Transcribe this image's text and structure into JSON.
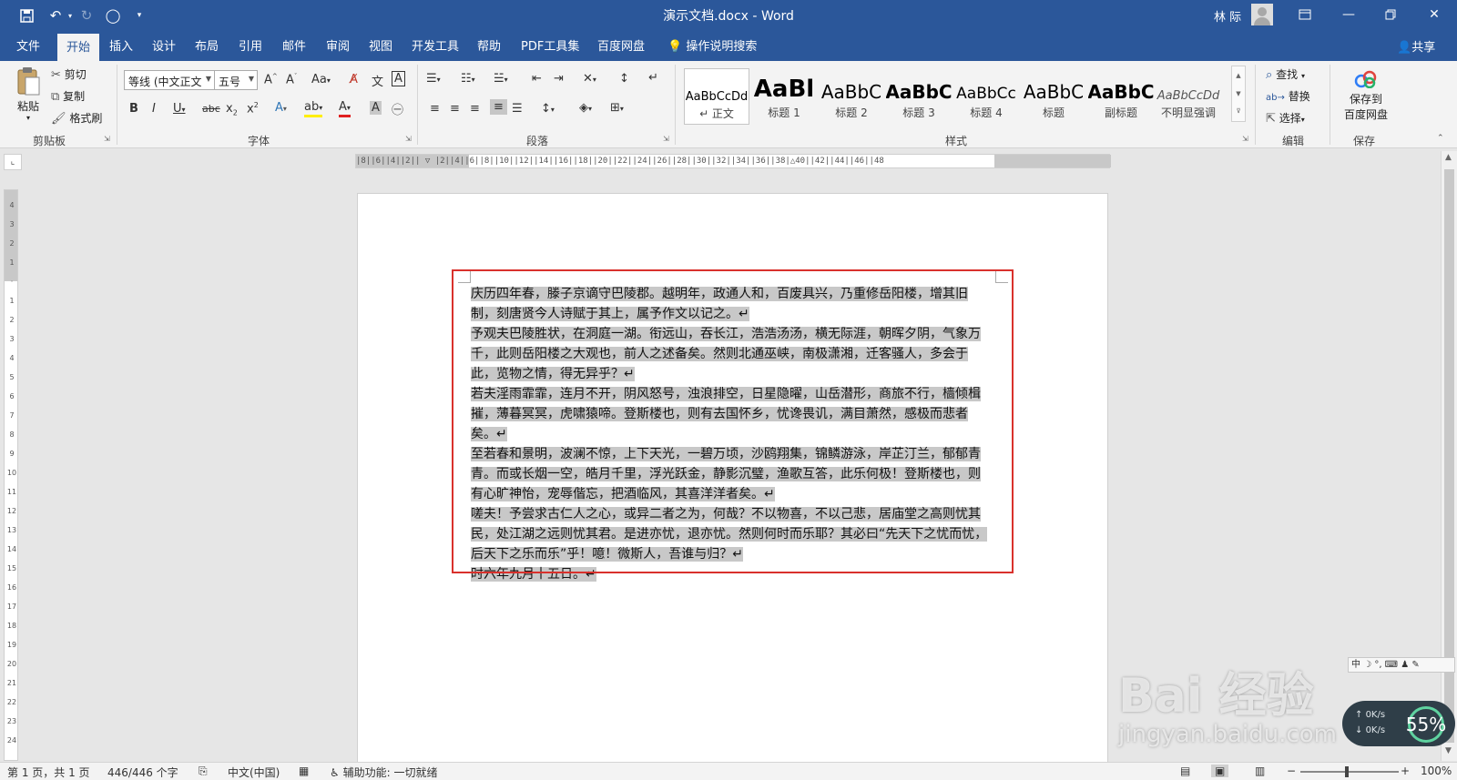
{
  "window": {
    "title": "演示文档.docx",
    "separator": "-",
    "app": "Word",
    "user": "林 际"
  },
  "tabs": [
    {
      "label": "文件"
    },
    {
      "label": "开始"
    },
    {
      "label": "插入"
    },
    {
      "label": "设计"
    },
    {
      "label": "布局"
    },
    {
      "label": "引用"
    },
    {
      "label": "邮件"
    },
    {
      "label": "审阅"
    },
    {
      "label": "视图"
    },
    {
      "label": "开发工具"
    },
    {
      "label": "帮助"
    },
    {
      "label": "PDF工具集"
    },
    {
      "label": "百度网盘"
    }
  ],
  "tell_me": "操作说明搜索",
  "share": "共享",
  "clipboard": {
    "paste": "粘贴",
    "cut": "剪切",
    "copy": "复制",
    "format_painter": "格式刷",
    "group": "剪贴板"
  },
  "font": {
    "name": "等线 (中文正文",
    "size": "五号",
    "group": "字体"
  },
  "paragraph": {
    "group": "段落"
  },
  "styles": {
    "group": "样式",
    "items": [
      {
        "sample": "AaBbCcDd",
        "name": "↵ 正文"
      },
      {
        "sample": "AaBl",
        "name": "标题 1"
      },
      {
        "sample": "AaBbC",
        "name": "标题 2"
      },
      {
        "sample": "AaBbC",
        "name": "标题 3"
      },
      {
        "sample": "AaBbCc",
        "name": "标题 4"
      },
      {
        "sample": "AaBbC",
        "name": "标题"
      },
      {
        "sample": "AaBbC",
        "name": "副标题"
      },
      {
        "sample": "AaBbCcDd",
        "name": "不明显强调"
      }
    ]
  },
  "editing": {
    "find": "查找",
    "replace": "替换",
    "select": "选择",
    "group": "编辑"
  },
  "save_group": {
    "button_line1": "保存到",
    "button_line2": "百度网盘",
    "group": "保存"
  },
  "document": {
    "paragraphs": [
      "庆历四年春，滕子京谪守巴陵郡。越明年，政通人和，百废具兴，乃重修岳阳楼，增其旧制，刻唐贤今人诗赋于其上，属予作文以记之。",
      "予观夫巴陵胜状，在洞庭一湖。衔远山，吞长江，浩浩汤汤，横无际涯，朝晖夕阴，气象万千，此则岳阳楼之大观也，前人之述备矣。然则北通巫峡，南极潇湘，迁客骚人，多会于此，览物之情，得无异乎？",
      "若夫淫雨霏霏，连月不开，阴风怒号，浊浪排空，日星隐曜，山岳潜形，商旅不行，樯倾楫摧，薄暮冥冥，虎啸猿啼。登斯楼也，则有去国怀乡，忧谗畏讥，满目萧然，感极而悲者矣。",
      "至若春和景明，波澜不惊，上下天光，一碧万顷，沙鸥翔集，锦鳞游泳，岸芷汀兰，郁郁青青。而或长烟一空，皓月千里，浮光跃金，静影沉璧，渔歌互答，此乐何极！登斯楼也，则有心旷神怡，宠辱偕忘，把酒临风，其喜洋洋者矣。",
      "嗟夫！予尝求古仁人之心，或异二者之为，何哉？不以物喜，不以己悲，居庙堂之高则忧其民，处江湖之远则忧其君。是进亦忧，退亦忧。然则何时而乐耶？其必曰“先天下之忧而忧，后天下之乐而乐”乎！噫！微斯人，吾谁与归？",
      "时六年九月十五日。"
    ],
    "para_mark": "↵"
  },
  "status": {
    "page": "第 1 页，共 1 页",
    "words": "446/446 个字",
    "language": "中文(中国)",
    "accessibility": "辅助功能: 一切就绪",
    "zoom": "100%"
  },
  "overlay": {
    "ime": "中 ☽ °, ⌨ ♟ ✎",
    "speed_up": "0K/s",
    "speed_down": "0K/s",
    "percent": "55%",
    "watermark_main": "Bai 经验",
    "watermark_url": "jingyan.baidu.com"
  },
  "colors": {
    "brand": "#2b579a",
    "ribbon": "#f3f3f3",
    "selection": "#c8c8c8",
    "highlight_box": "#d9312c"
  }
}
